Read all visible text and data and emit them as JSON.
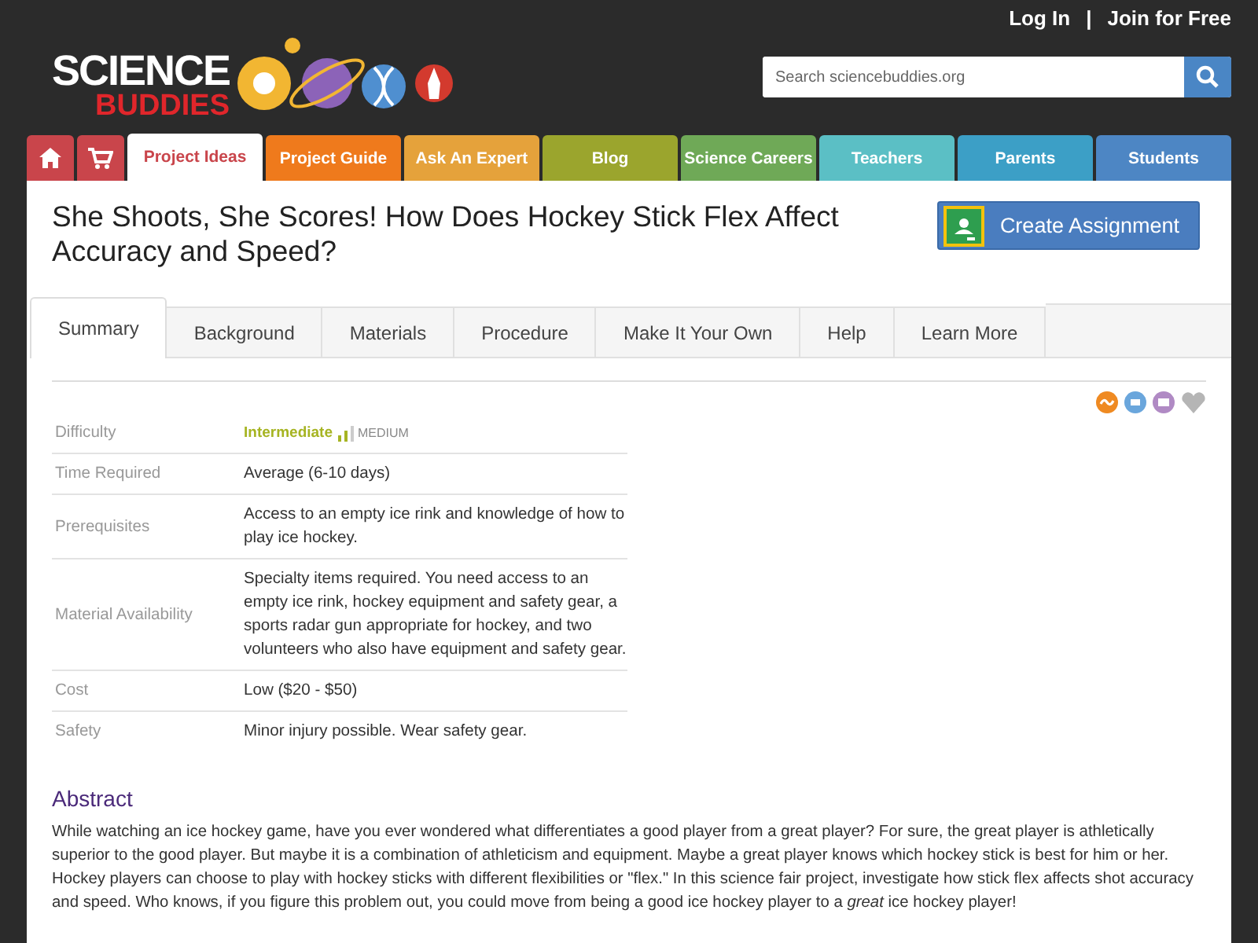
{
  "header": {
    "auth_links": [
      "Log In",
      "|",
      "Join for Free"
    ],
    "logo": {
      "line1": "SCIENCE",
      "line2": "BUDDIES"
    },
    "search": {
      "placeholder": "Search sciencebuddies.org"
    }
  },
  "nav": [
    {
      "kind": "home",
      "color": "#c9454b",
      "selected": false
    },
    {
      "kind": "cart",
      "color": "#c9454b",
      "selected": false
    },
    {
      "kind": "text",
      "label": "Project Ideas",
      "color": "#c9454b",
      "selected": true
    },
    {
      "kind": "text",
      "label": "Project Guide",
      "color": "#ef7a1c",
      "selected": false
    },
    {
      "kind": "text",
      "label": "Ask An Expert",
      "color": "#e5a23b",
      "selected": false
    },
    {
      "kind": "text",
      "label": "Blog",
      "color": "#9ba52d",
      "selected": false
    },
    {
      "kind": "text",
      "label": "Science Careers",
      "color": "#6fa957",
      "selected": false
    },
    {
      "kind": "text",
      "label": "Teachers",
      "color": "#5bbfc5",
      "selected": false
    },
    {
      "kind": "text",
      "label": "Parents",
      "color": "#3c9fc6",
      "selected": false
    },
    {
      "kind": "text",
      "label": "Students",
      "color": "#4d86c4",
      "selected": false
    }
  ],
  "title": "She Shoots, She Scores! How Does Hockey Stick Flex Affect Accuracy and Speed?",
  "create_button": "Create Assignment",
  "tabs": [
    {
      "label": "Summary",
      "selected": true
    },
    {
      "label": "Background",
      "selected": false
    },
    {
      "label": "Materials",
      "selected": false
    },
    {
      "label": "Procedure",
      "selected": false
    },
    {
      "label": "Make It Your Own",
      "selected": false
    },
    {
      "label": "Help",
      "selected": false
    },
    {
      "label": "Learn More",
      "selected": false
    }
  ],
  "share_icons": [
    {
      "kind": "share",
      "color": "#ef8a22"
    },
    {
      "kind": "print",
      "color": "#6aa6dc"
    },
    {
      "kind": "email",
      "color": "#b08ac4"
    },
    {
      "kind": "heart",
      "color": "#b5b5b5"
    }
  ],
  "details": [
    {
      "kind": "difficulty",
      "label": "Difficulty",
      "value": "Intermediate",
      "note": "MEDIUM"
    },
    {
      "kind": "text",
      "label": "Time Required",
      "value": "Average (6-10 days)"
    },
    {
      "kind": "text",
      "label": "Prerequisites",
      "value": "Access to an empty ice rink and knowledge of how to play ice hockey."
    },
    {
      "kind": "text",
      "label": "Material Availability",
      "value": "Specialty items required. You need access to an empty ice rink, hockey equipment and safety gear, a sports radar gun appropriate for hockey, and two volunteers who also have equipment and safety gear."
    },
    {
      "kind": "text",
      "label": "Cost",
      "value": "Low ($20 - $50)"
    },
    {
      "kind": "text",
      "label": "Safety",
      "value": "Minor injury possible. Wear safety gear."
    }
  ],
  "abstract": {
    "heading": "Abstract",
    "text": "While watching an ice hockey game, have you ever wondered what differentiates a good player from a great player? For sure, the great player is athletically superior to the good player. But maybe it is a combination of athleticism and equipment. Maybe a great player knows which hockey stick is best for him or her. Hockey players can choose to play with hockey sticks with different flexibilities or \"flex.\" In this science fair project, investigate how stick flex affects shot accuracy and speed. Who knows, if you figure this problem out, you could move from being a good ice hockey player to a *great* ice hockey player!"
  }
}
